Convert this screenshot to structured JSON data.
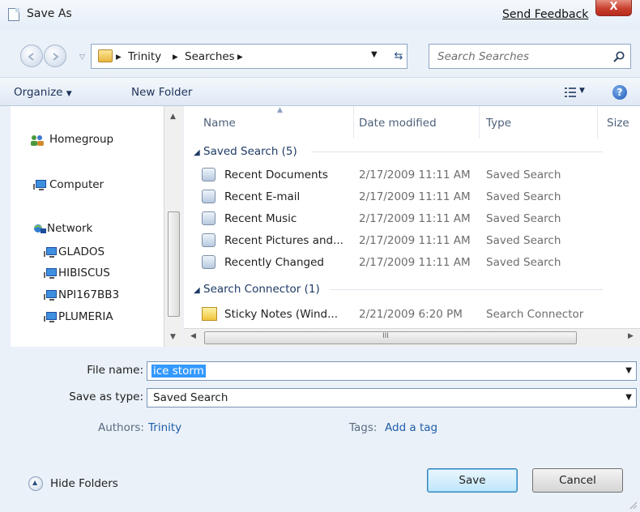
{
  "window": {
    "title": "Save As",
    "feedback_link": "Send Feedback",
    "close_glyph": "X"
  },
  "address": {
    "crumbs": [
      "Trinity",
      "Searches"
    ],
    "search_placeholder": "Search Searches"
  },
  "toolbar": {
    "organize": "Organize",
    "new_folder": "New Folder",
    "help_glyph": "?"
  },
  "navpane": {
    "items": [
      {
        "label": "Homegroup",
        "icon": "homegroup-icon"
      },
      {
        "label": "Computer",
        "icon": "computer-icon"
      },
      {
        "label": "Network",
        "icon": "network-icon"
      }
    ],
    "network_children": [
      "GLADOS",
      "HIBISCUS",
      "NPI167BB3",
      "PLUMERIA"
    ]
  },
  "filelist": {
    "columns": [
      "Name",
      "Date modified",
      "Type",
      "Size"
    ],
    "groups": [
      {
        "header": "Saved Search (5)",
        "rows": [
          {
            "name": "Recent Documents",
            "date": "2/17/2009 11:11 AM",
            "type": "Saved Search"
          },
          {
            "name": "Recent E-mail",
            "date": "2/17/2009 11:11 AM",
            "type": "Saved Search"
          },
          {
            "name": "Recent Music",
            "date": "2/17/2009 11:11 AM",
            "type": "Saved Search"
          },
          {
            "name": "Recent Pictures and...",
            "date": "2/17/2009 11:11 AM",
            "type": "Saved Search"
          },
          {
            "name": "Recently Changed",
            "date": "2/17/2009 11:11 AM",
            "type": "Saved Search"
          }
        ]
      },
      {
        "header": "Search Connector (1)",
        "rows": [
          {
            "name": "Sticky Notes (Wind...",
            "date": "2/21/2009 6:20 PM",
            "type": "Search Connector"
          }
        ]
      }
    ],
    "hscroll_grip": "III"
  },
  "form": {
    "file_name_label": "File name:",
    "file_name_value": "ice storm",
    "save_type_label": "Save as type:",
    "save_type_value": "Saved Search",
    "authors_label": "Authors:",
    "authors_value": "Trinity",
    "tags_label": "Tags:",
    "tags_value": "Add a tag"
  },
  "footer": {
    "hide_folders": "Hide Folders",
    "save": "Save",
    "cancel": "Cancel"
  },
  "colors": {
    "accent": "#3399ff",
    "link": "#1f5ea8",
    "close": "#c9402f"
  }
}
